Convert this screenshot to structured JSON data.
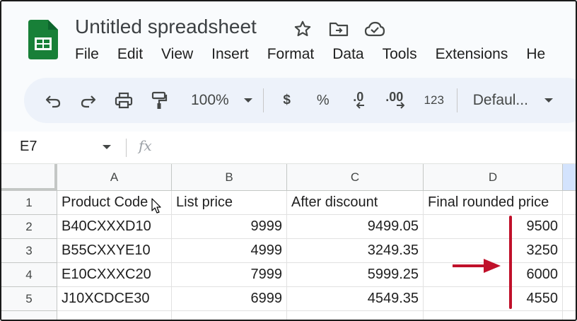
{
  "app": {
    "title": "Untitled spreadsheet",
    "brand_color": "#188038"
  },
  "menu": [
    "File",
    "Edit",
    "View",
    "Insert",
    "Format",
    "Data",
    "Tools",
    "Extensions",
    "He"
  ],
  "toolbar": {
    "zoom": "100%",
    "currency": "$",
    "percent": "%",
    "decrease_decimal": ".0",
    "increase_decimal": ".00",
    "number_format": "123",
    "font": "Defaul..."
  },
  "formula_bar": {
    "cell_ref": "E7",
    "fx": "fx"
  },
  "sheet": {
    "columns": [
      "A",
      "B",
      "C",
      "D"
    ],
    "rows": [
      {
        "num": "1",
        "cells": [
          "Product Code",
          "List price",
          "After discount",
          "Final rounded price"
        ]
      },
      {
        "num": "2",
        "cells": [
          "B40CXXXD10",
          "9999",
          "9499.05",
          "9500"
        ]
      },
      {
        "num": "3",
        "cells": [
          "B55CXXYE10",
          "4999",
          "3249.35",
          "3250"
        ]
      },
      {
        "num": "4",
        "cells": [
          "E10CXXXC20",
          "7999",
          "5999.25",
          "6000"
        ]
      },
      {
        "num": "5",
        "cells": [
          "J10XCDCE30",
          "6999",
          "4549.35",
          "4550"
        ]
      }
    ]
  },
  "annotation_color": "#c0102a"
}
